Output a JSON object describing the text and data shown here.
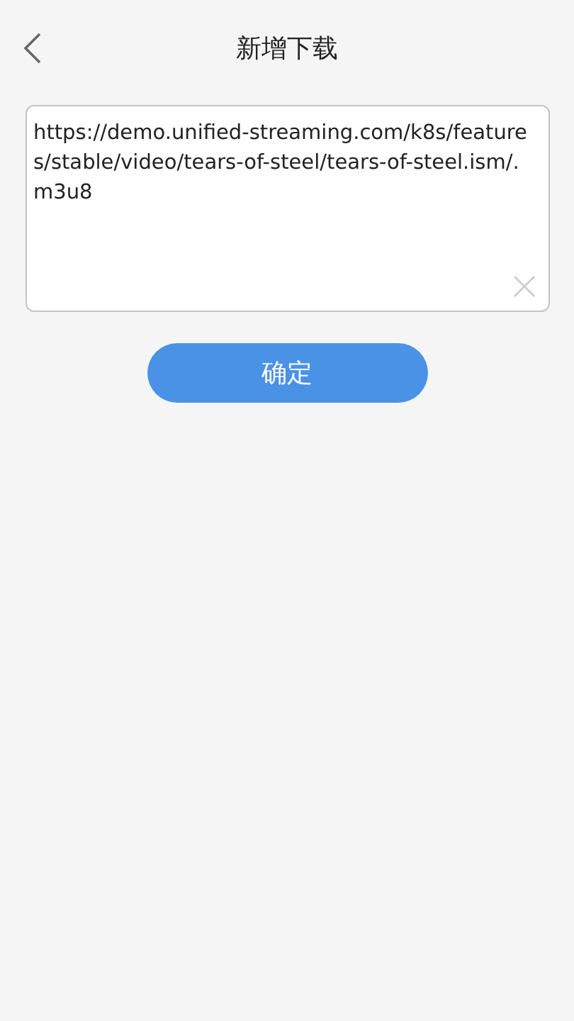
{
  "header": {
    "title": "新增下载"
  },
  "url_field": {
    "value": "https://demo.unified-streaming.com/k8s/features/stable/video/tears-of-steel/tears-of-steel.ism/.m3u8"
  },
  "confirm_button": {
    "label": "确定"
  }
}
